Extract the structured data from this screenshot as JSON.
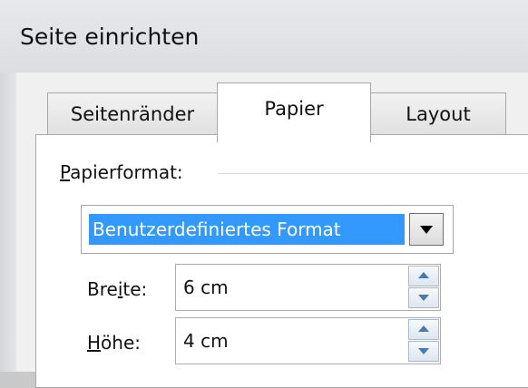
{
  "window": {
    "title": "Seite einrichten"
  },
  "tabs": [
    {
      "label": "Seitenränder",
      "active": false
    },
    {
      "label": "Papier",
      "active": true
    },
    {
      "label": "Layout",
      "active": false
    }
  ],
  "paper": {
    "group_label_mnemonic": "P",
    "group_label_rest": "apierformat:",
    "format_selected": "Benutzerdefiniertes Format",
    "width": {
      "label_before": "Bre",
      "label_mnemonic": "i",
      "label_after": "te:",
      "value": "6 cm"
    },
    "height": {
      "label_mnemonic": "H",
      "label_rest": "öhe:",
      "value": "4 cm"
    }
  },
  "icons": {
    "dropdown": "chevron-down-icon",
    "spin_up": "spin-up-icon",
    "spin_down": "spin-down-icon"
  },
  "colors": {
    "selection": "#3399ff",
    "spin_arrow": "#4a78b4"
  }
}
